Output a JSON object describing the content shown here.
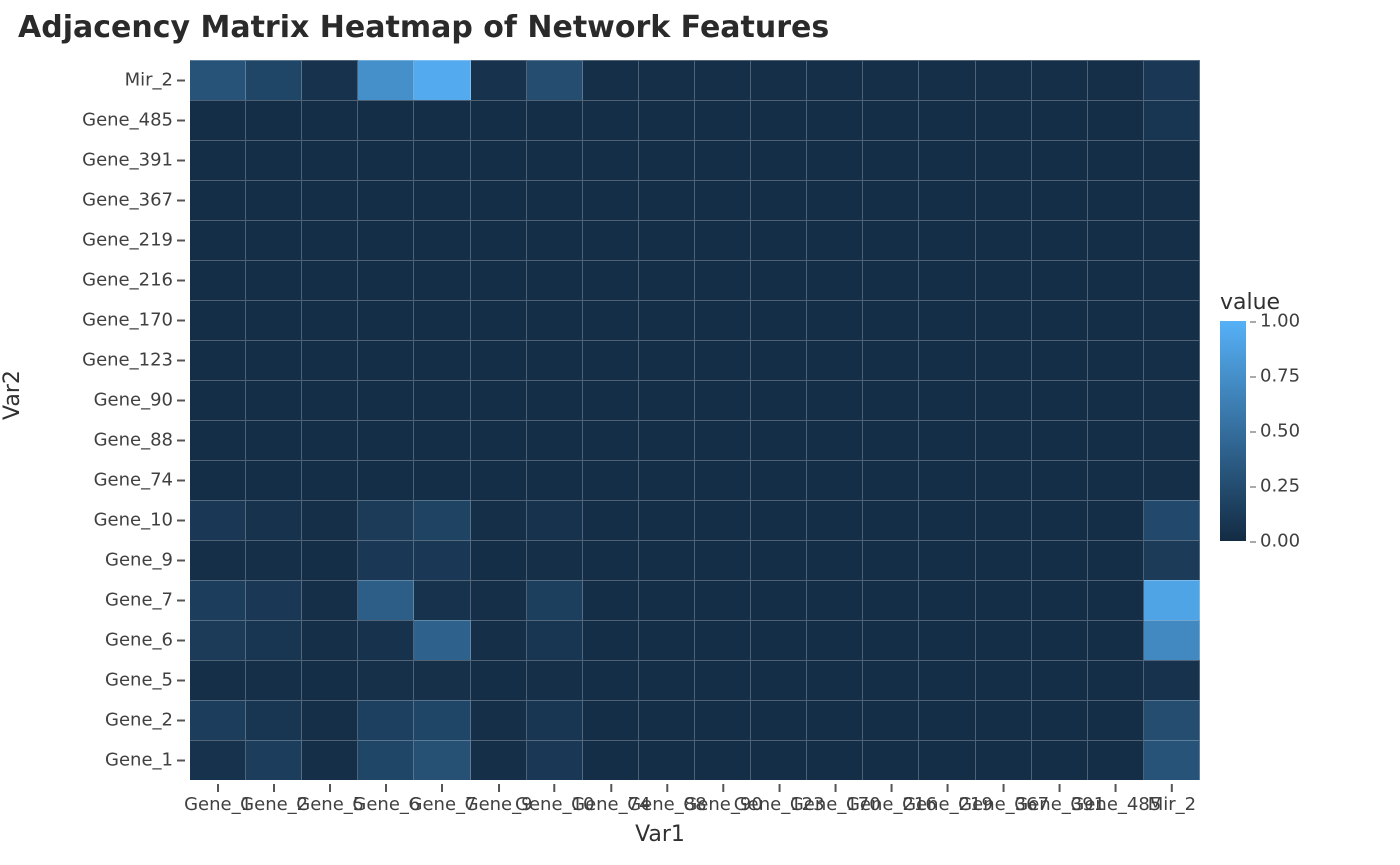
{
  "chart_data": {
    "type": "heatmap",
    "title": "Adjacency Matrix Heatmap of Network Features",
    "xlabel": "Var1",
    "ylabel": "Var2",
    "legend_title": "value",
    "color_low": "#132b43",
    "color_high": "#56b1f7",
    "value_range": [
      0.0,
      1.0
    ],
    "legend_ticks": [
      "0.00",
      "0.25",
      "0.50",
      "0.75",
      "1.00"
    ],
    "x_categories": [
      "Gene_1",
      "Gene_2",
      "Gene_5",
      "Gene_6",
      "Gene_7",
      "Gene_9",
      "Gene_10",
      "Gene_74",
      "Gene_88",
      "Gene_90",
      "Gene_123",
      "Gene_170",
      "Gene_216",
      "Gene_219",
      "Gene_367",
      "Gene_391",
      "Gene_485",
      "Mir_2"
    ],
    "y_categories_bottom_to_top": [
      "Gene_1",
      "Gene_2",
      "Gene_5",
      "Gene_6",
      "Gene_7",
      "Gene_9",
      "Gene_10",
      "Gene_74",
      "Gene_88",
      "Gene_90",
      "Gene_123",
      "Gene_170",
      "Gene_216",
      "Gene_219",
      "Gene_367",
      "Gene_391",
      "Gene_485",
      "Mir_2"
    ],
    "matrix_rows_top_to_bottom": [
      [
        0.3,
        0.2,
        0.05,
        0.75,
        0.95,
        0.05,
        0.25,
        0.03,
        0.03,
        0.03,
        0.03,
        0.03,
        0.03,
        0.03,
        0.03,
        0.03,
        0.03,
        0.1
      ],
      [
        0.02,
        0.02,
        0.02,
        0.02,
        0.02,
        0.02,
        0.02,
        0.02,
        0.02,
        0.02,
        0.02,
        0.02,
        0.02,
        0.02,
        0.02,
        0.02,
        0.02,
        0.08
      ],
      [
        0.02,
        0.02,
        0.02,
        0.02,
        0.02,
        0.02,
        0.02,
        0.02,
        0.02,
        0.02,
        0.02,
        0.02,
        0.02,
        0.02,
        0.02,
        0.02,
        0.02,
        0.03
      ],
      [
        0.02,
        0.02,
        0.02,
        0.02,
        0.02,
        0.02,
        0.02,
        0.02,
        0.02,
        0.02,
        0.02,
        0.02,
        0.02,
        0.02,
        0.02,
        0.02,
        0.02,
        0.03
      ],
      [
        0.02,
        0.02,
        0.02,
        0.02,
        0.02,
        0.02,
        0.02,
        0.02,
        0.02,
        0.02,
        0.02,
        0.02,
        0.02,
        0.02,
        0.02,
        0.02,
        0.02,
        0.03
      ],
      [
        0.02,
        0.02,
        0.02,
        0.02,
        0.02,
        0.02,
        0.02,
        0.02,
        0.02,
        0.02,
        0.02,
        0.02,
        0.02,
        0.02,
        0.02,
        0.02,
        0.02,
        0.03
      ],
      [
        0.02,
        0.02,
        0.02,
        0.02,
        0.02,
        0.02,
        0.02,
        0.02,
        0.02,
        0.02,
        0.02,
        0.02,
        0.02,
        0.02,
        0.02,
        0.02,
        0.02,
        0.03
      ],
      [
        0.02,
        0.02,
        0.02,
        0.02,
        0.02,
        0.02,
        0.02,
        0.02,
        0.02,
        0.02,
        0.02,
        0.02,
        0.02,
        0.02,
        0.02,
        0.02,
        0.02,
        0.03
      ],
      [
        0.02,
        0.02,
        0.02,
        0.02,
        0.02,
        0.02,
        0.02,
        0.02,
        0.02,
        0.02,
        0.02,
        0.02,
        0.02,
        0.02,
        0.02,
        0.02,
        0.02,
        0.03
      ],
      [
        0.02,
        0.02,
        0.02,
        0.02,
        0.02,
        0.02,
        0.02,
        0.02,
        0.02,
        0.02,
        0.02,
        0.02,
        0.02,
        0.02,
        0.02,
        0.02,
        0.02,
        0.03
      ],
      [
        0.02,
        0.02,
        0.02,
        0.02,
        0.02,
        0.02,
        0.02,
        0.02,
        0.02,
        0.02,
        0.02,
        0.02,
        0.02,
        0.02,
        0.02,
        0.02,
        0.02,
        0.03
      ],
      [
        0.1,
        0.05,
        0.03,
        0.12,
        0.18,
        0.03,
        0.05,
        0.02,
        0.02,
        0.02,
        0.02,
        0.02,
        0.02,
        0.02,
        0.02,
        0.02,
        0.02,
        0.22
      ],
      [
        0.03,
        0.03,
        0.02,
        0.1,
        0.1,
        0.02,
        0.03,
        0.02,
        0.02,
        0.02,
        0.02,
        0.02,
        0.02,
        0.02,
        0.02,
        0.02,
        0.02,
        0.12
      ],
      [
        0.14,
        0.1,
        0.03,
        0.38,
        0.05,
        0.03,
        0.15,
        0.02,
        0.02,
        0.02,
        0.02,
        0.02,
        0.02,
        0.02,
        0.02,
        0.02,
        0.02,
        0.9
      ],
      [
        0.12,
        0.08,
        0.03,
        0.05,
        0.4,
        0.03,
        0.08,
        0.02,
        0.02,
        0.02,
        0.02,
        0.02,
        0.02,
        0.02,
        0.02,
        0.02,
        0.02,
        0.7
      ],
      [
        0.03,
        0.03,
        0.02,
        0.04,
        0.04,
        0.02,
        0.03,
        0.02,
        0.02,
        0.02,
        0.02,
        0.02,
        0.02,
        0.02,
        0.02,
        0.02,
        0.02,
        0.05
      ],
      [
        0.14,
        0.08,
        0.03,
        0.16,
        0.2,
        0.03,
        0.08,
        0.02,
        0.02,
        0.02,
        0.02,
        0.02,
        0.02,
        0.02,
        0.02,
        0.02,
        0.02,
        0.25
      ],
      [
        0.05,
        0.14,
        0.03,
        0.2,
        0.28,
        0.03,
        0.1,
        0.02,
        0.02,
        0.02,
        0.02,
        0.02,
        0.02,
        0.02,
        0.02,
        0.02,
        0.02,
        0.3
      ]
    ]
  }
}
